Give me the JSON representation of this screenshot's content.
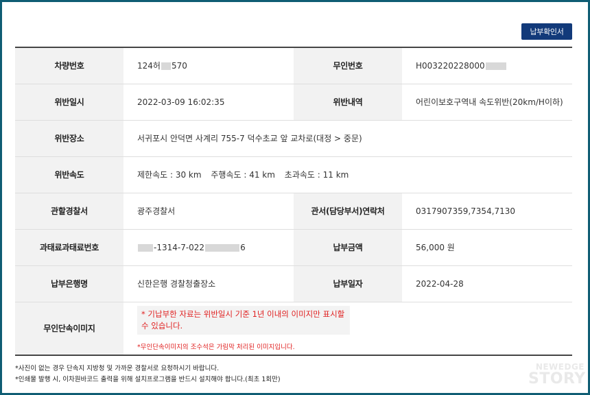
{
  "header": {
    "confirm_button_label": "납부확인서"
  },
  "rows": {
    "vehicle_number": {
      "label": "차량번호",
      "value_prefix": "124허",
      "value_suffix": "570"
    },
    "unmanned_number": {
      "label": "무인번호",
      "value_prefix": "H003220228000"
    },
    "violation_datetime": {
      "label": "위반일시",
      "value": "2022-03-09 16:02:35"
    },
    "violation_detail": {
      "label": "위반내역",
      "value": "어린이보호구역내 속도위반(20km/H이하)"
    },
    "violation_place": {
      "label": "위반장소",
      "value": "서귀포시 안덕면 사계리 755-7 덕수초교 앞 교차로(대정 > 중문)"
    },
    "violation_speed": {
      "label": "위반속도",
      "limit": "제한속도 : 30 km",
      "driving": "주행속도 : 41 km",
      "excess": "초과속도 : 11 km"
    },
    "police_station": {
      "label": "관할경찰서",
      "value": "광주경찰서"
    },
    "contact": {
      "label": "관서(담당부서)연락처",
      "value": "0317907359,7354,7130"
    },
    "fine_number": {
      "label": "과태료과태료번호",
      "value_mid": "-1314-7-022",
      "value_end": "6"
    },
    "payment_amount": {
      "label": "납부금액",
      "value": "56,000 원"
    },
    "payment_bank": {
      "label": "납부은행명",
      "value": "신한은행 경찰청출장소"
    },
    "payment_date": {
      "label": "납부일자",
      "value": "2022-04-28"
    },
    "enforcement_image": {
      "label": "무인단속이미지",
      "note": "* 기납부한 자료는 위반일시 기준 1년 이내의 이미지만 표시할 수 있습니다.",
      "note_small": "*무인단속이미지의 조수석은 가림막 처리된 이미지입니다."
    }
  },
  "footer": {
    "note1": "*사진이 없는 경우 단속지 지방청 및 가까운 경찰서로 요청하시기 바랍니다.",
    "note2": "*인쇄물 발행 시, 이차원바코드 출력을 위해 설치프로그램을 반드시 설치해야 합니다.(최초 1회만)"
  },
  "watermark": {
    "line1": "NEWEDGE",
    "line2": "STORY"
  },
  "colors": {
    "frame": "#0f5d73",
    "button": "#123a7a",
    "alert_text": "#e02020",
    "header_cell": "#f2f2f2"
  }
}
